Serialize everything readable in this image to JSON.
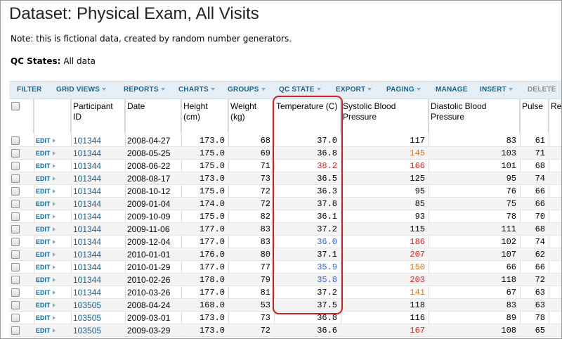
{
  "title": "Dataset: Physical Exam, All Visits",
  "note": "Note: this is fictional data, created by random number generators.",
  "qc": {
    "label": "QC States:",
    "value": "All data"
  },
  "toolbar": {
    "filter": "FILTER",
    "grid_views": "GRID VIEWS",
    "reports": "REPORTS",
    "charts": "CHARTS",
    "groups": "GROUPS",
    "qc_state": "QC STATE",
    "export": "EXPORT",
    "paging": "PAGING",
    "manage": "MANAGE",
    "insert": "INSERT",
    "delete": "DELETE"
  },
  "headers": {
    "participant": "Participant ID",
    "date": "Date",
    "height": "Height (cm)",
    "weight": "Weight (kg)",
    "temperature": "Temperature (C)",
    "systolic": "Systolic Blood Pressure",
    "diastolic": "Diastolic Blood Pressure",
    "pulse": "Pulse",
    "resp": "Res"
  },
  "edit_label": "EDIT",
  "colors": {
    "link": "#126495",
    "red": "#e02020",
    "orange": "#f07010",
    "blue": "#3060e0",
    "highlight": "#cc1f1f"
  },
  "rows": [
    {
      "participant": "101344",
      "date": "2008-04-27",
      "height": "173.0",
      "weight": "68",
      "temperature": "37.0",
      "temp_color": "",
      "systolic": "117",
      "sys_color": "",
      "diastolic": "83",
      "pulse": "61"
    },
    {
      "participant": "101344",
      "date": "2008-05-25",
      "height": "175.0",
      "weight": "69",
      "temperature": "36.8",
      "temp_color": "",
      "systolic": "145",
      "sys_color": "orange",
      "diastolic": "103",
      "pulse": "71"
    },
    {
      "participant": "101344",
      "date": "2008-06-22",
      "height": "175.0",
      "weight": "71",
      "temperature": "38.2",
      "temp_color": "red",
      "systolic": "166",
      "sys_color": "red",
      "diastolic": "101",
      "pulse": "68"
    },
    {
      "participant": "101344",
      "date": "2008-08-17",
      "height": "173.0",
      "weight": "73",
      "temperature": "36.5",
      "temp_color": "",
      "systolic": "125",
      "sys_color": "",
      "diastolic": "95",
      "pulse": "74"
    },
    {
      "participant": "101344",
      "date": "2008-10-12",
      "height": "175.0",
      "weight": "72",
      "temperature": "36.3",
      "temp_color": "",
      "systolic": "95",
      "sys_color": "",
      "diastolic": "76",
      "pulse": "66"
    },
    {
      "participant": "101344",
      "date": "2009-01-04",
      "height": "174.0",
      "weight": "72",
      "temperature": "37.8",
      "temp_color": "",
      "systolic": "85",
      "sys_color": "",
      "diastolic": "75",
      "pulse": "66"
    },
    {
      "participant": "101344",
      "date": "2009-10-09",
      "height": "175.0",
      "weight": "82",
      "temperature": "36.1",
      "temp_color": "",
      "systolic": "93",
      "sys_color": "",
      "diastolic": "78",
      "pulse": "70"
    },
    {
      "participant": "101344",
      "date": "2009-11-06",
      "height": "177.0",
      "weight": "83",
      "temperature": "37.2",
      "temp_color": "",
      "systolic": "115",
      "sys_color": "",
      "diastolic": "111",
      "pulse": "68"
    },
    {
      "participant": "101344",
      "date": "2009-12-04",
      "height": "177.0",
      "weight": "83",
      "temperature": "36.0",
      "temp_color": "blue",
      "systolic": "186",
      "sys_color": "red",
      "diastolic": "102",
      "pulse": "74"
    },
    {
      "participant": "101344",
      "date": "2010-01-01",
      "height": "176.0",
      "weight": "80",
      "temperature": "37.1",
      "temp_color": "",
      "systolic": "207",
      "sys_color": "red",
      "diastolic": "107",
      "pulse": "62"
    },
    {
      "participant": "101344",
      "date": "2010-01-29",
      "height": "177.0",
      "weight": "77",
      "temperature": "35.9",
      "temp_color": "blue",
      "systolic": "150",
      "sys_color": "orange",
      "diastolic": "66",
      "pulse": "66"
    },
    {
      "participant": "101344",
      "date": "2010-02-26",
      "height": "178.0",
      "weight": "79",
      "temperature": "35.8",
      "temp_color": "blue",
      "systolic": "203",
      "sys_color": "red",
      "diastolic": "118",
      "pulse": "72"
    },
    {
      "participant": "101344",
      "date": "2010-03-26",
      "height": "177.0",
      "weight": "81",
      "temperature": "37.2",
      "temp_color": "",
      "systolic": "141",
      "sys_color": "orange",
      "diastolic": "67",
      "pulse": "63"
    },
    {
      "participant": "103505",
      "date": "2008-04-24",
      "height": "168.0",
      "weight": "53",
      "temperature": "37.5",
      "temp_color": "",
      "systolic": "118",
      "sys_color": "",
      "diastolic": "83",
      "pulse": "63"
    },
    {
      "participant": "103505",
      "date": "2009-03-01",
      "height": "173.0",
      "weight": "73",
      "temperature": "36.8",
      "temp_color": "",
      "systolic": "116",
      "sys_color": "",
      "diastolic": "89",
      "pulse": "78"
    },
    {
      "participant": "103505",
      "date": "2009-03-29",
      "height": "173.0",
      "weight": "72",
      "temperature": "36.6",
      "temp_color": "",
      "systolic": "167",
      "sys_color": "red",
      "diastolic": "108",
      "pulse": "65"
    }
  ]
}
